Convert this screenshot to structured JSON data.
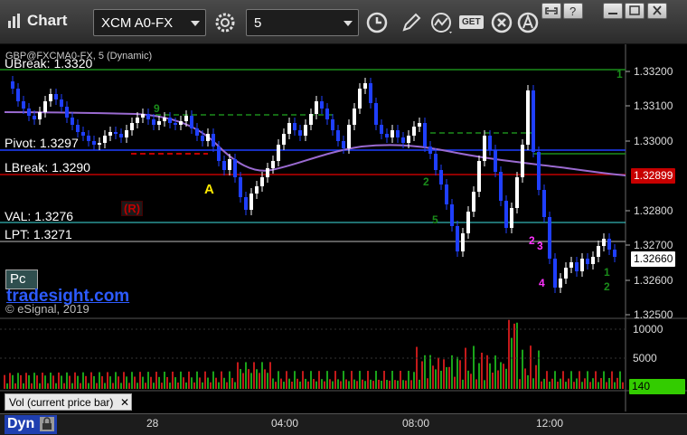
{
  "app": {
    "title": "Chart"
  },
  "toolbar": {
    "symbol": "XCM A0-FX",
    "interval": "5",
    "get_label": "GET"
  },
  "chart": {
    "symbol_line": "GBP@FXCMA0-FX, 5 (Dynamic)",
    "levels": {
      "ubreak": "UBreak: 1.3320",
      "pivot": "Pivot: 1.3297",
      "lbreak": "LBreak: 1.3290",
      "val": "VAL: 1.3276",
      "lpt": "LPT: 1.3271"
    },
    "r_marker": "(R)",
    "a_marker": "A",
    "pc_label": "Pc",
    "brand": "tradesight.com",
    "copyright": "© eSignal, 2019",
    "price_axis": [
      "1.33200",
      "1.33100",
      "1.33000",
      "1.32800",
      "1.32700",
      "1.32600",
      "1.32500"
    ],
    "price_tags": {
      "mid": "1.32899",
      "last": "1.32660"
    },
    "volume_axis": [
      "10000",
      "5000"
    ],
    "volume_tag": "140",
    "volume_label": "Vol (current price bar)",
    "time_axis": [
      "28",
      "04:00",
      "08:00",
      "12:00"
    ],
    "bottom_label": "Dyn",
    "colors": {
      "up": "#ffffff",
      "down": "#1f3fff",
      "ubreak": "#1a8c1a",
      "lbreak": "#c00000",
      "pivot": "#1f3fff",
      "val": "#40e0e0",
      "ma": "#9a6ad0",
      "mid_tag": "#c80000",
      "vol_tag": "#33cc00"
    }
  }
}
